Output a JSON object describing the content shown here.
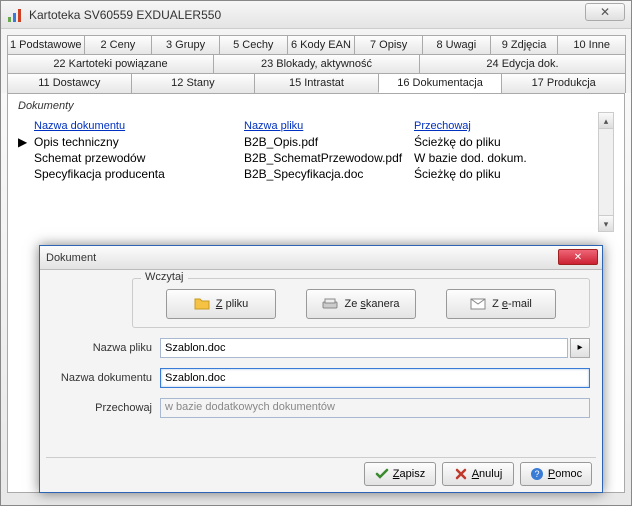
{
  "window": {
    "title": "Kartoteka  SV60559  EXDUALER550"
  },
  "tabs": {
    "row1": [
      "1 Podstawowe",
      "2 Ceny",
      "3 Grupy",
      "5 Cechy",
      "6 Kody EAN",
      "7 Opisy",
      "8 Uwagi",
      "9 Zdjęcia",
      "10 Inne"
    ],
    "row2": [
      "22 Kartoteki powiązane",
      "23 Blokady, aktywność",
      "24 Edycja dok."
    ],
    "row3": [
      "11 Dostawcy",
      "12 Stany",
      "15 Intrastat",
      "16 Dokumentacja",
      "17 Produkcja"
    ],
    "active": "16 Dokumentacja"
  },
  "grid": {
    "label": "Dokumenty",
    "headers": [
      "Nazwa dokumentu",
      "Nazwa pliku",
      "Przechowaj"
    ],
    "rows": [
      {
        "selected": true,
        "name": "Opis techniczny",
        "file": "B2B_Opis.pdf",
        "store": "Ścieżkę do pliku"
      },
      {
        "selected": false,
        "name": "Schemat przewodów",
        "file": "B2B_SchematPrzewodow.pdf",
        "store": "W bazie dod. dokum."
      },
      {
        "selected": false,
        "name": "Specyfikacja producenta",
        "file": "B2B_Specyfikacja.doc",
        "store": "Ścieżkę do pliku"
      }
    ]
  },
  "dialog": {
    "title": "Dokument",
    "group_label": "Wczytaj",
    "buttons": {
      "from_file": "Z pliku",
      "from_scanner": "Ze skanera",
      "from_email": "Z e-mail"
    },
    "labels": {
      "file_name": "Nazwa pliku",
      "doc_name": "Nazwa dokumentu",
      "store": "Przechowaj"
    },
    "values": {
      "file_name": "Szablon.doc",
      "doc_name": "Szablon.doc",
      "store": "w bazie dodatkowych dokumentów"
    },
    "footer": {
      "save": "Zapisz",
      "cancel": "Anuluj",
      "help": "Pomoc"
    }
  }
}
